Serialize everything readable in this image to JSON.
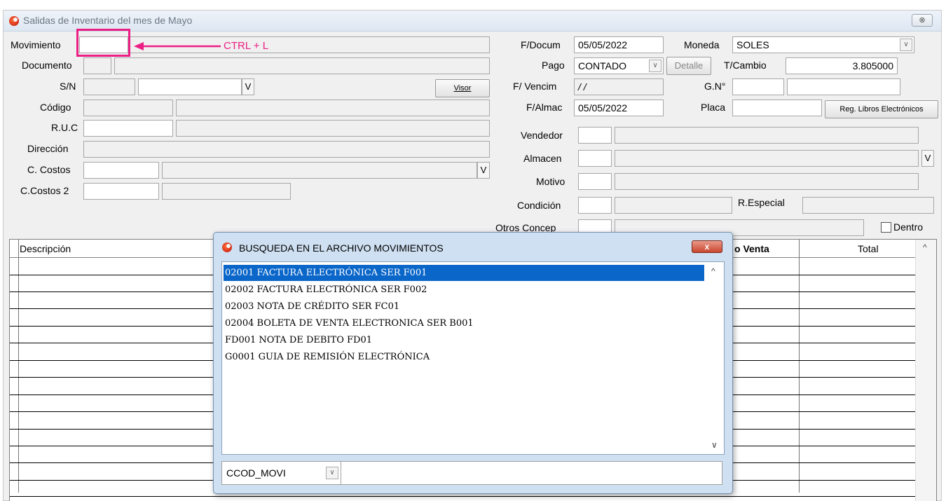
{
  "window": {
    "title": "Salidas de Inventario del mes de Mayo",
    "close_glyph": "⊗"
  },
  "annotation": {
    "text": "CTRL + L"
  },
  "left_form": {
    "movimiento_label": "Movimiento",
    "documento_label": "Documento",
    "sn_label": "S/N",
    "sn_v": "V",
    "visor_label": "Visor",
    "codigo_label": "Código",
    "ruc_label": "R.U.C",
    "direccion_label": "Dirección",
    "ccostos_label": "C. Costos",
    "ccostos_v": "V",
    "ccostos2_label": "C.Costos 2"
  },
  "right_form": {
    "fdocum_label": "F/Docum",
    "fdocum_value": "05/05/2022",
    "moneda_label": "Moneda",
    "moneda_value": "SOLES",
    "pago_label": "Pago",
    "pago_value": "CONTADO",
    "detalle_label": "Detalle",
    "tcambio_label": "T/Cambio",
    "tcambio_value": "3.805000",
    "fvencim_label": "F/ Vencim",
    "fvencim_value": "/ /",
    "gn_label": "G.N°",
    "falmac_label": "F/Almac",
    "falmac_value": "05/05/2022",
    "placa_label": "Placa",
    "reg_libros_label": "Reg. Libros Electrónicos",
    "vendedor_label": "Vendedor",
    "almacen_label": "Almacen",
    "almacen_v": "V",
    "motivo_label": "Motivo",
    "condicion_label": "Condición",
    "respecial_label": "R.Especial",
    "otros_concep_label": "Otros Concep",
    "dentro_label": "Dentro"
  },
  "grid": {
    "columns": [
      "Descripción",
      "o Venta",
      "Total"
    ]
  },
  "dialog": {
    "title": "BUSQUEDA EN EL ARCHIVO MOVIMIENTOS",
    "close_label": "x",
    "items": [
      "02001 FACTURA ELECTRÓNICA SER F001",
      "02002 FACTURA ELECTRÓNICA SER F002",
      "02003 NOTA DE CRÉDITO SER FC01",
      "02004 BOLETA DE VENTA ELECTRONICA SER B001",
      "FD001 NOTA DE DEBITO FD01",
      "G0001 GUIA DE REMISIÓN ELECTRÓNICA"
    ],
    "selected_index": 0,
    "search_field_value": "CCOD_MOVI",
    "search_value": ""
  },
  "colors": {
    "accent": "#0a66c9",
    "annotation": "#ec1e84"
  },
  "icons": {
    "app": "app-logo-icon",
    "dropdown": "chevron-down-icon",
    "scroll_up": "chevron-up-icon",
    "scroll_down": "chevron-down-icon"
  }
}
